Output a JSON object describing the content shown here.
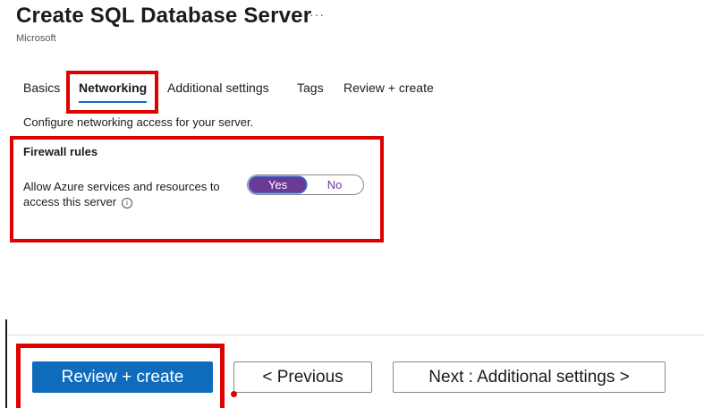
{
  "header": {
    "title": "Create SQL Database Server",
    "more_label": "···",
    "publisher": "Microsoft"
  },
  "tabs": [
    {
      "label": "Basics",
      "active": false
    },
    {
      "label": "Networking",
      "active": true
    },
    {
      "label": "Additional settings",
      "active": false
    },
    {
      "label": "Tags",
      "active": false
    },
    {
      "label": "Review + create",
      "active": false
    }
  ],
  "networking": {
    "description": "Configure networking access for your server.",
    "firewall_title": "Firewall rules",
    "allow_azure_label": "Allow Azure services and resources to access this server",
    "info_icon": "i",
    "toggle": {
      "yes_label": "Yes",
      "no_label": "No",
      "selected": "Yes"
    }
  },
  "footer": {
    "review_create_label": "Review + create",
    "previous_label": "< Previous",
    "next_label": "Next : Additional settings >"
  },
  "colors": {
    "primary": "#0f6cbd",
    "highlight": "#e00000",
    "toggle_selected": "#6b3a96"
  }
}
